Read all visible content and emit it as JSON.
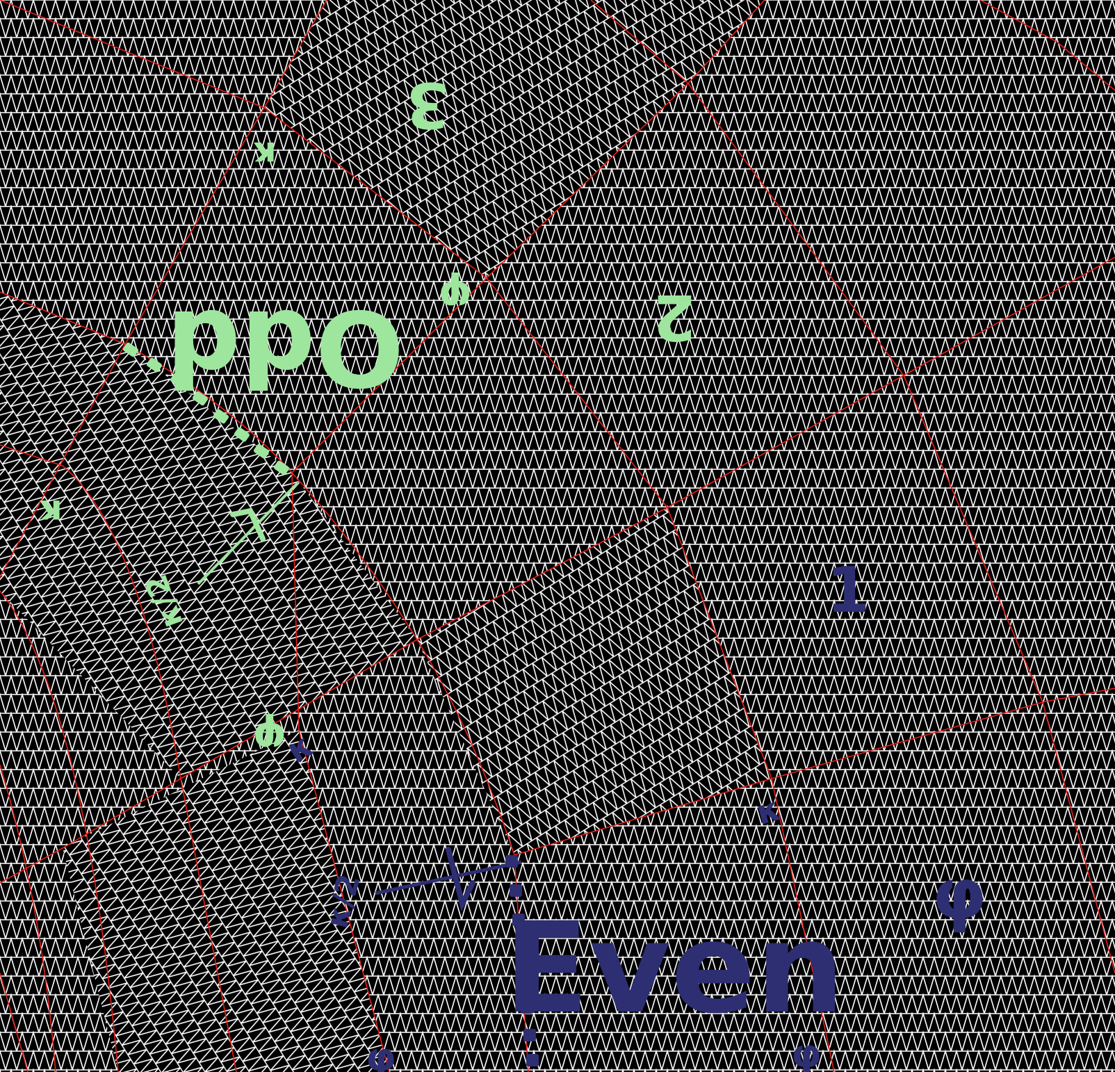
{
  "colors": {
    "mesh_background": "#000000",
    "mesh_lines": "#ffffff",
    "patch_boundaries": "#e8201a",
    "odd_annotation": "#9ee69e",
    "even_annotation": "#2e2e72"
  },
  "annotations": {
    "odd": {
      "label": "Odd",
      "patch_numbers": [
        "3",
        "2"
      ],
      "kappa_symbol": "κ",
      "phi_symbol": "φ",
      "fraction_label": "κ/2"
    },
    "even": {
      "label": "Even",
      "patch_numbers": [
        "1"
      ],
      "kappa_symbol": "κ",
      "phi_symbol": "φ",
      "fraction_label": "κ/2"
    }
  }
}
